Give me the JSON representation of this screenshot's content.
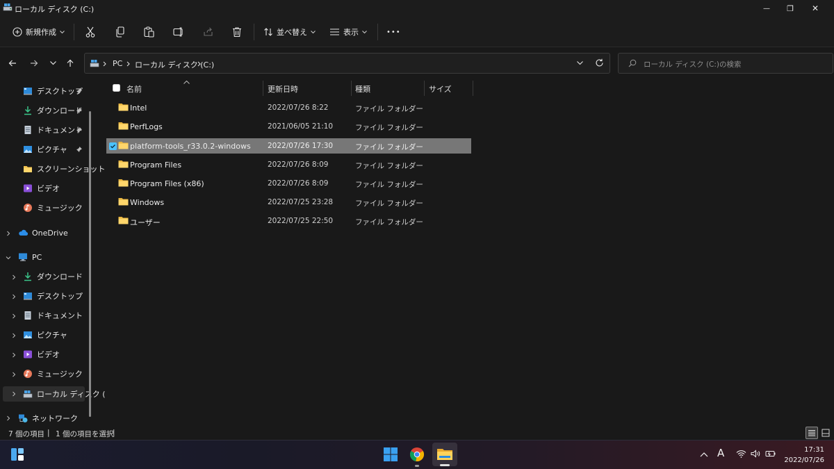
{
  "window": {
    "title": "ローカル ディスク (C:)",
    "minimize_glyph": "—",
    "maximize_glyph": "❐",
    "close_glyph": "✕"
  },
  "commandbar": {
    "new_label": "新規作成",
    "sort_label": "並べ替え",
    "view_label": "表示",
    "more_glyph": "•••"
  },
  "address": {
    "crumbs": [
      "PC",
      "ローカル ディスク (C:)"
    ],
    "search_placeholder": "ローカル ディスク (C:)の検索"
  },
  "sidebar": {
    "quick_access": [
      {
        "label": "デスクトップ",
        "icon": "desktop-icon",
        "pinned": true
      },
      {
        "label": "ダウンロード",
        "icon": "download-icon",
        "pinned": true
      },
      {
        "label": "ドキュメント",
        "icon": "document-icon",
        "pinned": true
      },
      {
        "label": "ピクチャ",
        "icon": "picture-icon",
        "pinned": true
      },
      {
        "label": "スクリーンショット",
        "icon": "folder-icon",
        "pinned": false
      },
      {
        "label": "ビデオ",
        "icon": "video-icon",
        "pinned": false
      },
      {
        "label": "ミュージック",
        "icon": "music-icon",
        "pinned": false
      }
    ],
    "onedrive": "OneDrive",
    "pc": "PC",
    "pc_children": [
      {
        "label": "ダウンロード",
        "icon": "download-icon"
      },
      {
        "label": "デスクトップ",
        "icon": "desktop-icon"
      },
      {
        "label": "ドキュメント",
        "icon": "document-icon"
      },
      {
        "label": "ピクチャ",
        "icon": "picture-icon"
      },
      {
        "label": "ビデオ",
        "icon": "video-icon"
      },
      {
        "label": "ミュージック",
        "icon": "music-icon"
      },
      {
        "label": "ローカル ディスク (",
        "icon": "drive-icon"
      }
    ],
    "network": "ネットワーク"
  },
  "filelist": {
    "columns": {
      "name": "名前",
      "date": "更新日時",
      "type": "種類",
      "size": "サイズ"
    },
    "rows": [
      {
        "name": "Intel",
        "date": "2022/07/26 8:22",
        "type": "ファイル フォルダー",
        "selected": false
      },
      {
        "name": "PerfLogs",
        "date": "2021/06/05 21:10",
        "type": "ファイル フォルダー",
        "selected": false
      },
      {
        "name": "platform-tools_r33.0.2-windows",
        "date": "2022/07/26 17:30",
        "type": "ファイル フォルダー",
        "selected": true
      },
      {
        "name": "Program Files",
        "date": "2022/07/26 8:09",
        "type": "ファイル フォルダー",
        "selected": false
      },
      {
        "name": "Program Files (x86)",
        "date": "2022/07/26 8:09",
        "type": "ファイル フォルダー",
        "selected": false
      },
      {
        "name": "Windows",
        "date": "2022/07/25 23:28",
        "type": "ファイル フォルダー",
        "selected": false
      },
      {
        "name": "ユーザー",
        "date": "2022/07/25 22:50",
        "type": "ファイル フォルダー",
        "selected": false
      }
    ]
  },
  "status": {
    "item_count": "7 個の項目",
    "selected_count": "1 個の項目を選択",
    "divider": "|"
  },
  "taskbar": {
    "ime": "A",
    "time": "17:31",
    "date": "2022/07/26"
  },
  "colors": {
    "folder": "#f2c14e",
    "selection": "#777777",
    "accent": "#4cc2ff"
  }
}
